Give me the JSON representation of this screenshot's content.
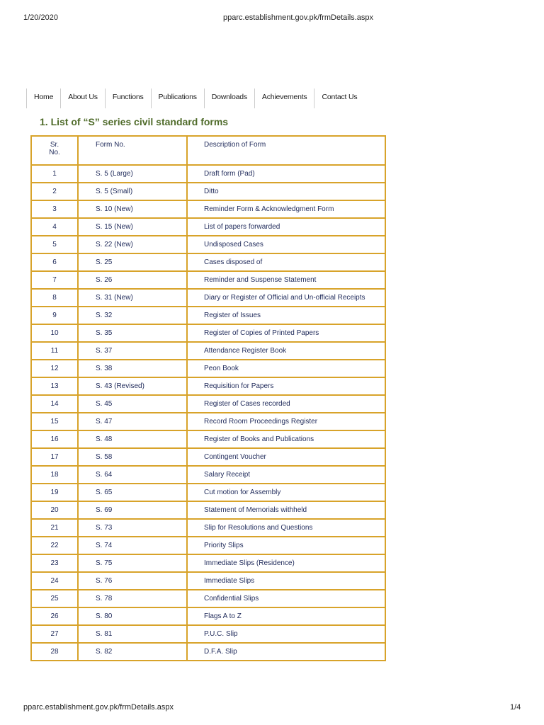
{
  "print_header": {
    "date": "1/20/2020",
    "url": "pparc.establishment.gov.pk/frmDetails.aspx"
  },
  "nav": [
    "Home",
    "About Us",
    "Functions",
    "Publications",
    "Downloads",
    "Achievements",
    "Contact Us"
  ],
  "title": "1. List of “S” series civil standard forms",
  "table": {
    "headers": [
      "Sr. No.",
      "Form No.",
      "Description of Form"
    ],
    "rows": [
      [
        "1",
        "S. 5 (Large)",
        "Draft form (Pad)"
      ],
      [
        "2",
        "S. 5 (Small)",
        "Ditto"
      ],
      [
        "3",
        "S. 10 (New)",
        "Reminder Form & Acknowledgment Form"
      ],
      [
        "4",
        "S. 15 (New)",
        "List of papers forwarded"
      ],
      [
        "5",
        "S. 22 (New)",
        "Undisposed Cases"
      ],
      [
        "6",
        "S. 25",
        "Cases disposed of"
      ],
      [
        "7",
        "S. 26",
        "Reminder and Suspense Statement"
      ],
      [
        "8",
        "S. 31 (New)",
        "Diary or Register of Official and Un-official Receipts"
      ],
      [
        "9",
        "S. 32",
        "Register of Issues"
      ],
      [
        "10",
        "S. 35",
        "Register of Copies of Printed Papers"
      ],
      [
        "11",
        "S. 37",
        "Attendance Register Book"
      ],
      [
        "12",
        "S. 38",
        "Peon Book"
      ],
      [
        "13",
        "S. 43 (Revised)",
        "Requisition for Papers"
      ],
      [
        "14",
        "S. 45",
        "Register of Cases recorded"
      ],
      [
        "15",
        "S. 47",
        "Record Room Proceedings Register"
      ],
      [
        "16",
        "S. 48",
        "Register of Books and Publications"
      ],
      [
        "17",
        "S. 58",
        "Contingent Voucher"
      ],
      [
        "18",
        "S. 64",
        "Salary Receipt"
      ],
      [
        "19",
        "S. 65",
        "Cut motion for Assembly"
      ],
      [
        "20",
        "S. 69",
        "Statement of Memorials withheld"
      ],
      [
        "21",
        "S. 73",
        "Slip for Resolutions and Questions"
      ],
      [
        "22",
        "S. 74",
        "Priority Slips"
      ],
      [
        "23",
        "S. 75",
        "Immediate Slips (Residence)"
      ],
      [
        "24",
        "S. 76",
        "Immediate Slips"
      ],
      [
        "25",
        "S. 78",
        "Confidential Slips"
      ],
      [
        "26",
        "S. 80",
        "Flags A to Z"
      ],
      [
        "27",
        "S. 81",
        "P.U.C.  Slip"
      ],
      [
        "28",
        "S. 82",
        "D.F.A.  Slip"
      ]
    ]
  },
  "print_footer": {
    "url": "pparc.establishment.gov.pk/frmDetails.aspx",
    "page": "1/4"
  }
}
